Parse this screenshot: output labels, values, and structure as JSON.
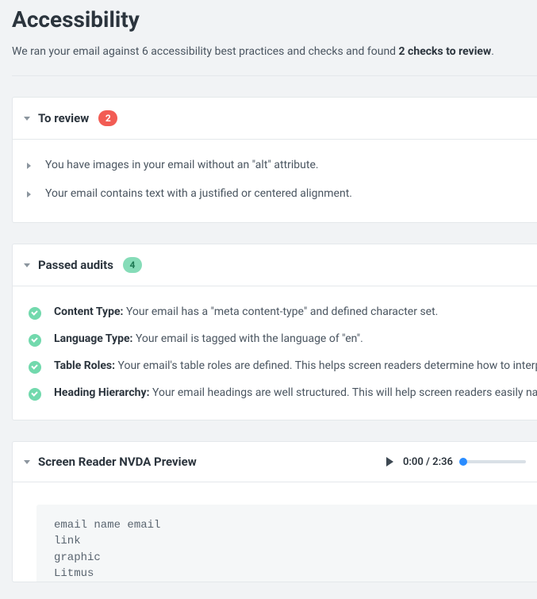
{
  "page": {
    "title": "Accessibility",
    "intro_prefix": "We ran your email against 6 accessibility best practices and checks and found ",
    "intro_bold": "2 checks to review",
    "intro_suffix": "."
  },
  "to_review": {
    "title": "To review",
    "count": "2",
    "items": [
      "You have images in your email without an \"alt\" attribute.",
      "Your email contains text with a justified or centered alignment."
    ]
  },
  "passed": {
    "title": "Passed audits",
    "count": "4",
    "items": [
      {
        "label": "Content Type:",
        "text": " Your email has a \"meta content-type\" and defined character set."
      },
      {
        "label": "Language Type:",
        "text": " Your email is tagged with the language of \"en\"."
      },
      {
        "label": "Table Roles:",
        "text": " Your email's table roles are defined. This helps screen readers determine how to interpret"
      },
      {
        "label": "Heading Hierarchy:",
        "text": " Your email headings are well structured. This will help screen readers easily navigate"
      }
    ]
  },
  "preview": {
    "title": "Screen Reader NVDA Preview",
    "time": "0:00 / 2:36",
    "transcript": "email name email\nlink\ngraphic\nLitmus"
  }
}
